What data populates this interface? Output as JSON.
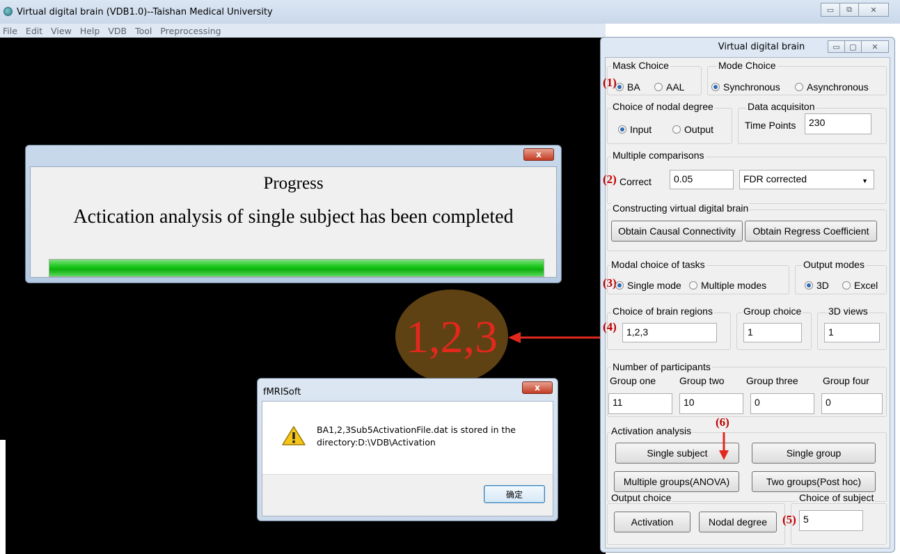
{
  "window": {
    "title": "Virtual digital brain (VDB1.0)--Taishan Medical University",
    "menu": [
      "File",
      "Edit",
      "View",
      "Help",
      "VDB",
      "Tool",
      "Preprocessing"
    ]
  },
  "progress_dialog": {
    "close_glyph": "x",
    "title": "Progress",
    "message": "Actication analysis of single subject has been completed",
    "progress": 1.0
  },
  "annotation": {
    "label": "1,2,3",
    "color": "#e2281d"
  },
  "message_box": {
    "title": "fMRISoft",
    "close_glyph": "x",
    "text": "BA1,2,3Sub5ActivationFile.dat  is stored in the directory:D:\\VDB\\Activation",
    "ok_label": "确定",
    "icon": "warning-icon"
  },
  "panel": {
    "title": "Virtual  digital  brain",
    "mask_choice": {
      "label": "Mask Choice",
      "options": [
        "BA",
        "AAL"
      ],
      "selected": "BA"
    },
    "mode_choice": {
      "label": "Mode Choice",
      "options": [
        "Synchronous",
        "Asynchronous"
      ],
      "selected": "Synchronous"
    },
    "nodal_degree": {
      "label": "Choice of nodal degree",
      "options": [
        "Input",
        "Output"
      ],
      "selected": "Input"
    },
    "data_acquisition": {
      "label": "Data acquisiton",
      "time_points_label": "Time Points",
      "time_points_value": "230"
    },
    "multiple_comparisons": {
      "label": "Multiple comparisons",
      "correct_label": "Correct",
      "correct_value": "0.05",
      "method": "FDR corrected"
    },
    "constructing": {
      "label": "Constructing virtual digital brain",
      "button1": "Obtain  Causal Connectivity",
      "button2": "Obtain Regress Coefficient"
    },
    "modal_choice": {
      "label": "Modal choice of tasks",
      "options": [
        "Single mode",
        "Multiple modes"
      ],
      "selected": "Single mode"
    },
    "output_modes": {
      "label": "Output modes",
      "options": [
        "3D",
        "Excel"
      ],
      "selected": "3D"
    },
    "brain_regions": {
      "label": "Choice of brain regions",
      "value": "1,2,3"
    },
    "group_choice": {
      "label": "Group choice",
      "value": "1"
    },
    "views_3d": {
      "label": "3D views",
      "value": "1"
    },
    "participants": {
      "label": "Number of participants",
      "groups": [
        {
          "name": "Group one",
          "value": "11"
        },
        {
          "name": "Group two",
          "value": "10"
        },
        {
          "name": "Group three",
          "value": "0"
        },
        {
          "name": "Group four",
          "value": "0"
        }
      ]
    },
    "activation": {
      "label": "Activation analysis",
      "single_subject": "Single subject",
      "single_group": "Single group",
      "multiple_groups": "Multiple groups(ANOVA)",
      "two_groups": "Two groups(Post hoc)"
    },
    "output_choice": {
      "label": "Output choice",
      "activation": "Activation",
      "nodal_degree": "Nodal degree"
    },
    "subject_choice": {
      "label": "Choice of subject",
      "value": "5"
    },
    "markers": [
      "(1)",
      "(2)",
      "(3)",
      "(4)",
      "(5)",
      "(6)"
    ]
  }
}
